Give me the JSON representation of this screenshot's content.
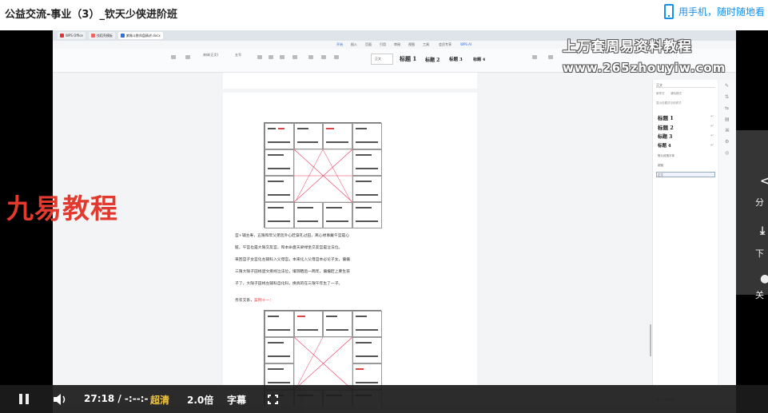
{
  "header": {
    "course_title": "公益交流-事业（3）_钦天少侠进阶班",
    "mobile_link": "用手机，随时随地看"
  },
  "watermarks": {
    "line1": "上万套周易资料教程",
    "line2": "www.265zhouyiw.com",
    "brand": "九易教程"
  },
  "wps": {
    "tabs": [
      "WPS Office",
      "找稻壳模板",
      "紫微斗数命盘精讲.docx"
    ],
    "menu": [
      "开始",
      "插入",
      "页面",
      "引用",
      "审阅",
      "视图",
      "工具",
      "会员专享",
      "WPS AI"
    ],
    "styles_preview": [
      "标题 1",
      "标题 2",
      "标题 3",
      "标题 4"
    ],
    "font_name": "宋体(正文)",
    "font_size": "五号",
    "style_normal": "正文"
  },
  "document": {
    "lines": [
      "宫+辅主寿，五限和年父弟皆外心赶穿孔过田，离心禄事戴午宫是心",
      "脏，午宫也是大限交友宫，和本命盘天梁禄坐交友宫是泣法位。",
      "来回宫子女宫化左辅科入父母宫，本来化入父母宫本必论子女，偏偏",
      "三限大限子田线蛋文疾线泣法位，壤洞晒后一两年，偏偏赶上要生孩",
      "子了，大限子田线左辅科自化科，换真的在三限午年生了一子。"
    ],
    "case_prefix": "务农交系，",
    "case_red": "案例十一："
  },
  "styles_panel": {
    "heading": "正文",
    "tabs": [
      "新样式",
      "清除格式"
    ],
    "subtitle": "显示在模式中的样式",
    "items": [
      "标题 1",
      "标题 2",
      "标题 3",
      "标题 4"
    ],
    "small_items": [
      "默认段落字体",
      "超链",
      "正文"
    ],
    "footer": "显示：有效样式"
  },
  "side_actions": [
    {
      "icon": "share-icon",
      "label": "分"
    },
    {
      "icon": "download-icon",
      "label": "下"
    },
    {
      "icon": "light-icon",
      "label": "关"
    }
  ],
  "player": {
    "time": "27:18 / -:--:-",
    "quality": "超清",
    "speed": "2.0倍",
    "subtitles": "字幕",
    "progress": 0.5
  },
  "colors": {
    "accent": "#1a8fe8",
    "quality": "#f2c230",
    "brand_red": "#e23a2f"
  }
}
